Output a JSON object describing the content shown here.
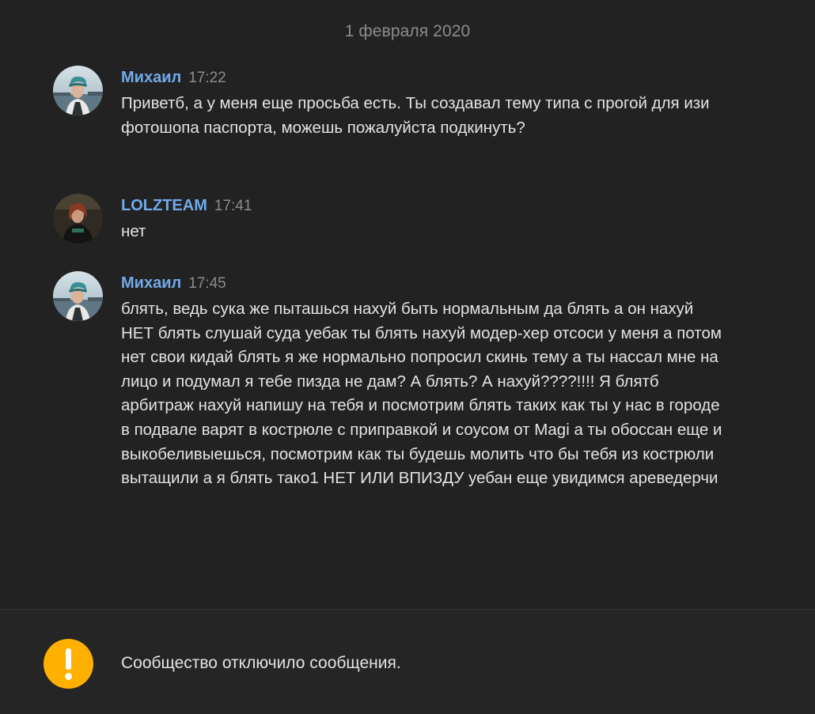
{
  "date_separator": "1 февраля 2020",
  "messages": [
    {
      "author": "Михаил",
      "time": "17:22",
      "text": "Приветб, а у меня еще просьба есть. Ты создавал тему типа с прогой для изи фотошопа паспорта, можешь пожалуйста подкинуть?",
      "avatar_icon": "user-avatar-mikhail"
    },
    {
      "author": "LOLZTEAM",
      "time": "17:41",
      "text": "нет",
      "avatar_icon": "user-avatar-lolzteam"
    },
    {
      "author": "Михаил",
      "time": "17:45",
      "text": "блять, ведь сука же пыташься нахуй быть нормальным да блять а он нахуй НЕТ блять слушай суда уебак ты блять нахуй модер-хер отсоси у меня а потом нет свои кидай блять я же нормально попросил скинь тему а ты нассал мне на лицо и подумал я тебе пизда не дам? А блять? А нахуй????!!!! Я блятб арбитраж нахуй напишу на тебя и посмотрим блять таких как ты у нас в городе в подвале варят в кострюле с приправкой и соусом от Magi а ты обоссан еще и выкобеливыешься, посмотрим как ты будешь молить что бы тебя из кострюли вытащили а я блять тако1 НЕТ ИЛИ ВПИЗДУ уебан еще увидимся ареведерчи",
      "avatar_icon": "user-avatar-mikhail"
    }
  ],
  "footer": {
    "notice": "Сообщество отключило сообщения.",
    "icon": "warning-icon"
  },
  "colors": {
    "background": "#222222",
    "author_link": "#71aaeb",
    "muted_text": "#8a8c8f",
    "message_text": "#e1e3e6",
    "warning": "#ffb000"
  }
}
